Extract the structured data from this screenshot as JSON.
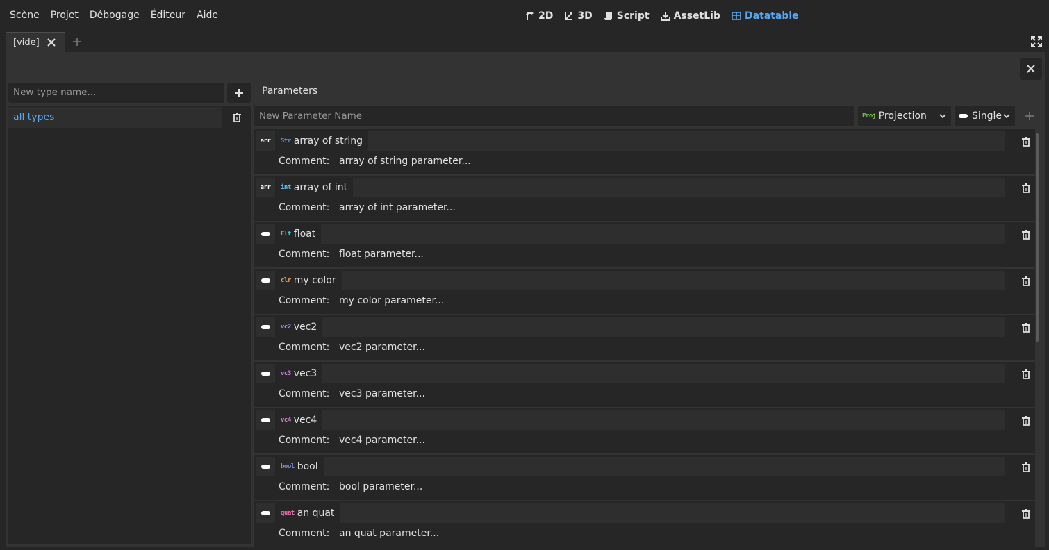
{
  "menu": {
    "items": [
      "Scène",
      "Projet",
      "Débogage",
      "Éditeur",
      "Aide"
    ]
  },
  "workspaces": {
    "w2d": "2D",
    "w3d": "3D",
    "script": "Script",
    "assetlib": "AssetLib",
    "datatable": "Datatable",
    "active_color": "#56a8f5"
  },
  "tabs": {
    "current": "[vide]"
  },
  "types_panel": {
    "new_type_placeholder": "New type name...",
    "items": [
      "all types"
    ]
  },
  "parameters": {
    "title": "Parameters",
    "new_param_placeholder": "New Parameter Name",
    "type_select": {
      "badge": "Proj",
      "value": "Projection"
    },
    "mode_select": {
      "value": "Single"
    },
    "comment_label": "Comment:",
    "rows": [
      {
        "kind": "arr",
        "badge": "Str",
        "badge_color": "#5b8fe8",
        "name": "array of string",
        "comment": "array of string parameter..."
      },
      {
        "kind": "arr",
        "badge": "int",
        "badge_color": "#62b8e8",
        "name": "array of int",
        "comment": "array of int parameter..."
      },
      {
        "kind": "single",
        "badge": "Flt",
        "badge_color": "#35d1d6",
        "name": "float",
        "comment": "float parameter..."
      },
      {
        "kind": "single",
        "badge": "clr",
        "badge_color": "#e0a060",
        "name": "my color",
        "comment": "my color parameter..."
      },
      {
        "kind": "single",
        "badge": "vc2",
        "badge_color": "#b08cf0",
        "name": "vec2",
        "comment": "vec2 parameter..."
      },
      {
        "kind": "single",
        "badge": "vc3",
        "badge_color": "#d47ee8",
        "name": "vec3",
        "comment": "vec3 parameter..."
      },
      {
        "kind": "single",
        "badge": "vc4",
        "badge_color": "#e07ee0",
        "name": "vec4",
        "comment": "vec4 parameter..."
      },
      {
        "kind": "single",
        "badge": "bool",
        "badge_color": "#7f8ff0",
        "name": "bool",
        "comment": "bool parameter..."
      },
      {
        "kind": "single",
        "badge": "quat",
        "badge_color": "#f06ab0",
        "name": "an quat",
        "comment": "an quat parameter..."
      }
    ]
  }
}
